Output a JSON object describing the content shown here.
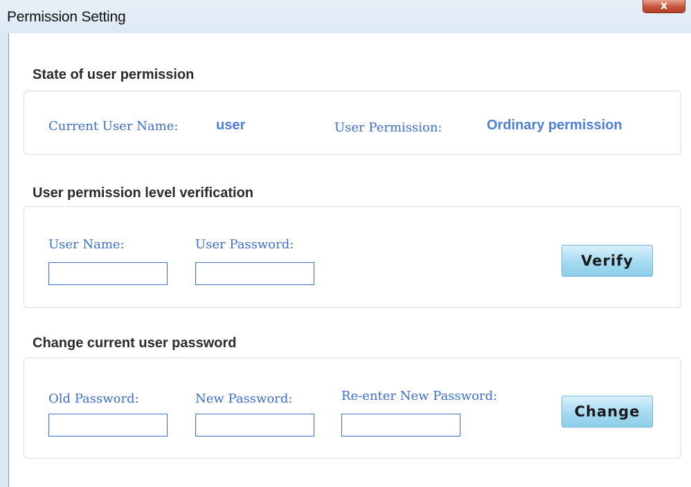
{
  "window": {
    "title": "Permission Setting",
    "close_label": "x"
  },
  "state_section": {
    "title": "State of user permission",
    "current_user_label": "Current User Name:",
    "current_user_value": "user",
    "permission_label": "User Permission:",
    "permission_value": "Ordinary permission"
  },
  "verify_section": {
    "title": "User permission level verification",
    "user_name_label": "User Name:",
    "user_name_value": "",
    "user_password_label": "User Password:",
    "user_password_value": "",
    "verify_button": "Verify"
  },
  "change_section": {
    "title": "Change current user password",
    "old_password_label": "Old Password:",
    "old_password_value": "",
    "new_password_label": "New Password:",
    "new_password_value": "",
    "reenter_password_label": "Re-enter New Password:",
    "reenter_password_value": "",
    "change_button": "Change"
  },
  "colors": {
    "label_blue": "#3a6fc8",
    "value_blue": "#4d7fd6",
    "button_blue": "#a9dcf2",
    "close_red": "#c5553c"
  }
}
